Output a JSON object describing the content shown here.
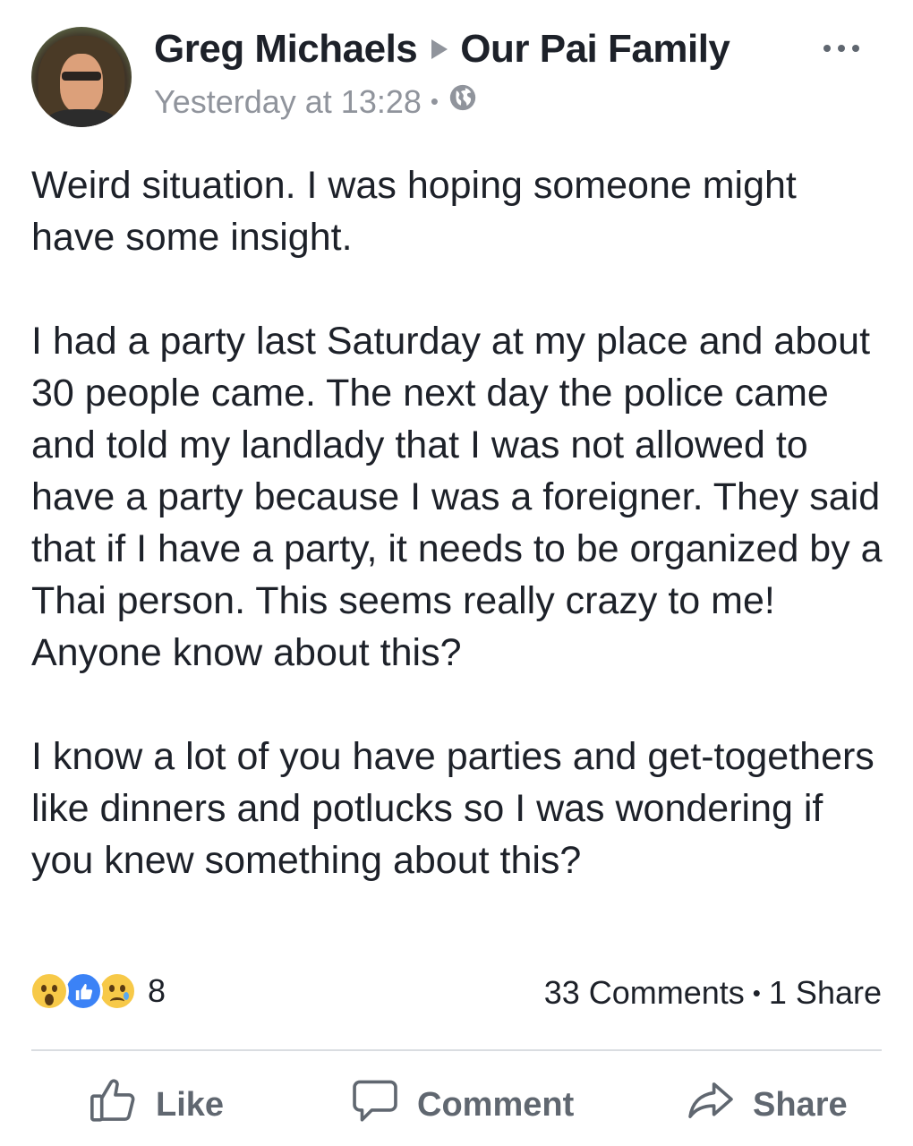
{
  "post": {
    "author": "Greg Michaels",
    "group": "Our Pai Family",
    "timestamp": "Yesterday at 13:28",
    "separator": "•",
    "privacy_icon": "globe-icon",
    "paragraphs": [
      "Weird situation. I was hoping someone might have some insight.",
      "I had a party last Saturday at my place and about 30 people came. The next day the police came and told my landlady that I was not allowed to have a party because I was a foreigner. They said that if I have a party, it needs to be organized by a Thai person. This seems really crazy to me! Anyone know about this?",
      "I know a lot of you have parties and get-togethers like dinners and potlucks so I was wondering if you knew something about this?"
    ]
  },
  "reactions": {
    "types": [
      "wow-reaction-icon",
      "like-reaction-icon",
      "sad-reaction-icon"
    ],
    "count": "8"
  },
  "engagement": {
    "comments": "33 Comments",
    "separator": "•",
    "shares": "1 Share"
  },
  "actions": {
    "like_label": "Like",
    "comment_label": "Comment",
    "share_label": "Share"
  },
  "colors": {
    "text": "#1d2129",
    "secondary": "#90949c",
    "action": "#606770",
    "like_blue": "#3b82f6",
    "reaction_yellow": "#f7c948"
  }
}
